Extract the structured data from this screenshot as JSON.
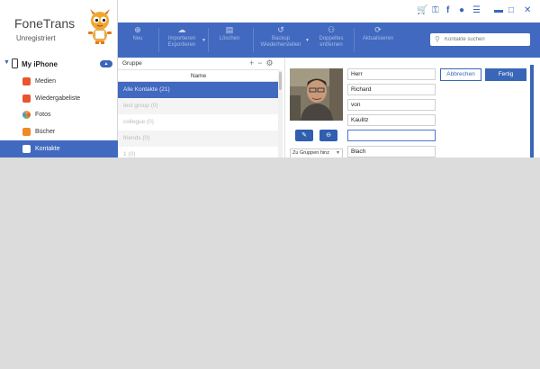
{
  "app": {
    "name": "FoneTrans",
    "registration": "Unregistriert"
  },
  "device": {
    "name": "My iPhone"
  },
  "sidebar": {
    "items": [
      {
        "label": "Medien",
        "icon": "music-icon",
        "color": "#e8552f"
      },
      {
        "label": "Wiedergabeliste",
        "icon": "playlist-icon",
        "color": "#e8552f"
      },
      {
        "label": "Fotos",
        "icon": "photos-icon",
        "color": "#f4a03c"
      },
      {
        "label": "Bücher",
        "icon": "books-icon",
        "color": "#f08a24"
      },
      {
        "label": "Kontakte",
        "icon": "contacts-icon",
        "color": "#ffffff",
        "active": true
      }
    ]
  },
  "toolbar": {
    "new": "Neu",
    "import_line1": "Importieren",
    "import_line2": "Exportieren",
    "delete": "Löschen",
    "backup_line1": "Backup",
    "backup_line2": "Wiederherstellen",
    "dup_line1": "Doppeltes",
    "dup_line2": "entfernen",
    "refresh": "Aktualisieren"
  },
  "search": {
    "placeholder": "Kontakte suchen"
  },
  "groups": {
    "header": "Gruppe",
    "column": "Name",
    "rows": [
      "Alle Kontakte  (21)",
      "test group  (0)",
      "collegue  (0)",
      "friends  (0)",
      "1  (0)"
    ]
  },
  "contact": {
    "fields": [
      "Herr",
      "Richard",
      "von",
      "Kaulitz",
      "",
      "Blach"
    ],
    "group_select": "Zu Gruppen hinz",
    "cancel": "Abbrechen",
    "done": "Fertig"
  },
  "colors": {
    "accent": "#4169bf",
    "button": "#3a66b8"
  }
}
